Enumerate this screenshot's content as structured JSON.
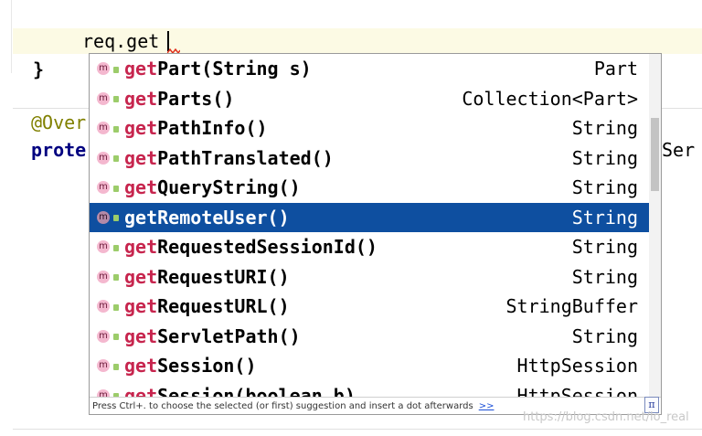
{
  "editor": {
    "line1": "req.get",
    "line2": "}",
    "line3": "@Over",
    "line4": "prote",
    "right_fragment": "Ser"
  },
  "completion": {
    "items": [
      {
        "prefix": "get",
        "rest": "Part(String s)",
        "type": "Part",
        "selected": false
      },
      {
        "prefix": "get",
        "rest": "Parts()",
        "type": "Collection<Part>",
        "selected": false
      },
      {
        "prefix": "get",
        "rest": "PathInfo()",
        "type": "String",
        "selected": false
      },
      {
        "prefix": "get",
        "rest": "PathTranslated()",
        "type": "String",
        "selected": false
      },
      {
        "prefix": "get",
        "rest": "QueryString()",
        "type": "String",
        "selected": false
      },
      {
        "prefix": "get",
        "rest": "RemoteUser()",
        "type": "String",
        "selected": true
      },
      {
        "prefix": "get",
        "rest": "RequestedSessionId()",
        "type": "String",
        "selected": false
      },
      {
        "prefix": "get",
        "rest": "RequestURI()",
        "type": "String",
        "selected": false
      },
      {
        "prefix": "get",
        "rest": "RequestURL()",
        "type": "StringBuffer",
        "selected": false
      },
      {
        "prefix": "get",
        "rest": "ServletPath()",
        "type": "String",
        "selected": false
      },
      {
        "prefix": "get",
        "rest": "Session()",
        "type": "HttpSession",
        "selected": false
      },
      {
        "prefix": "get",
        "rest": "Session(boolean b)",
        "type": "HttpSession",
        "selected": false
      }
    ],
    "icon_label": "m",
    "footer_text": "Press Ctrl+. to choose the selected (or first) suggestion and insert a dot afterwards",
    "footer_link": ">>",
    "pi_label": "π"
  },
  "watermark": "https://blog.csdn.net/lo_real",
  "colors": {
    "selection": "#0e4fa0",
    "prefix": "#c7254e",
    "keyword": "#000080",
    "annotation": "#808000"
  }
}
